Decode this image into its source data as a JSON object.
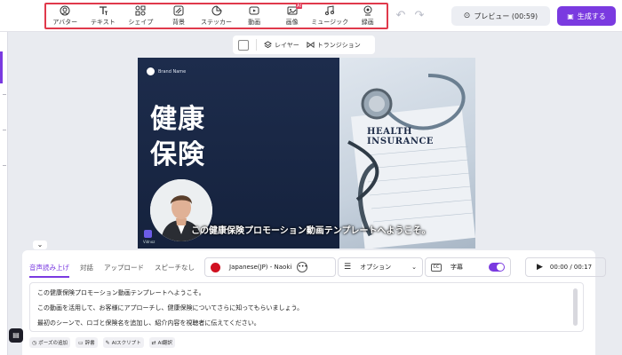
{
  "toolbar": {
    "tools": [
      {
        "label": "アバター",
        "icon": "avatar-icon"
      },
      {
        "label": "テキスト",
        "icon": "text-icon"
      },
      {
        "label": "シェイプ",
        "icon": "shape-icon"
      },
      {
        "label": "背景",
        "icon": "background-icon"
      },
      {
        "label": "ステッカー",
        "icon": "sticker-icon"
      },
      {
        "label": "動画",
        "icon": "video-icon"
      },
      {
        "label": "画像",
        "icon": "image-icon",
        "badge": "AI"
      },
      {
        "label": "ミュージック",
        "icon": "music-icon"
      },
      {
        "label": "録画",
        "icon": "record-icon"
      }
    ],
    "preview_label": "プレビュー (00:59)",
    "generate_label": "生成する"
  },
  "canvas": {
    "layer_label": "レイヤー",
    "transition_label": "トランジション"
  },
  "frame": {
    "brand_name": "Brand Name",
    "title_line1": "健康",
    "title_line2": "保険",
    "doc_title": "HEALTH INSURANCE",
    "subtitle": "この健康保険プロモーション動画テンプレートへようこそ。",
    "watermark": "Vidnoz"
  },
  "panel": {
    "tabs": [
      "音声読み上げ",
      "対話",
      "アップロード",
      "スピーチなし"
    ],
    "active_tab": 0,
    "voice_label": "Japanese(JP) - Naoki",
    "option_label": "オプション",
    "caption_label": "字幕",
    "caption_on": true,
    "time_label": "00:00 / 00:17",
    "script_lines": [
      "この健康保険プロモーション動画テンプレートへようこそ。",
      "この動画を活用して、お客様にアプローチし、健康保険についてさらに知ってもらいましょう。",
      "最初のシーンで、ロゴと保険名を追加し、紹介内容を視聴者に伝えてください。"
    ],
    "chips": [
      {
        "label": "ポーズの追加",
        "icon": "clock-icon"
      },
      {
        "label": "辞書",
        "icon": "dictionary-icon"
      },
      {
        "label": "AIスクリプト",
        "icon": "ai-script-icon"
      },
      {
        "label": "AI翻訳",
        "icon": "translate-icon"
      }
    ]
  },
  "colors": {
    "accent": "#7a3ae0",
    "highlight": "#e0394b",
    "frame_dark": "#1c2b4a"
  }
}
